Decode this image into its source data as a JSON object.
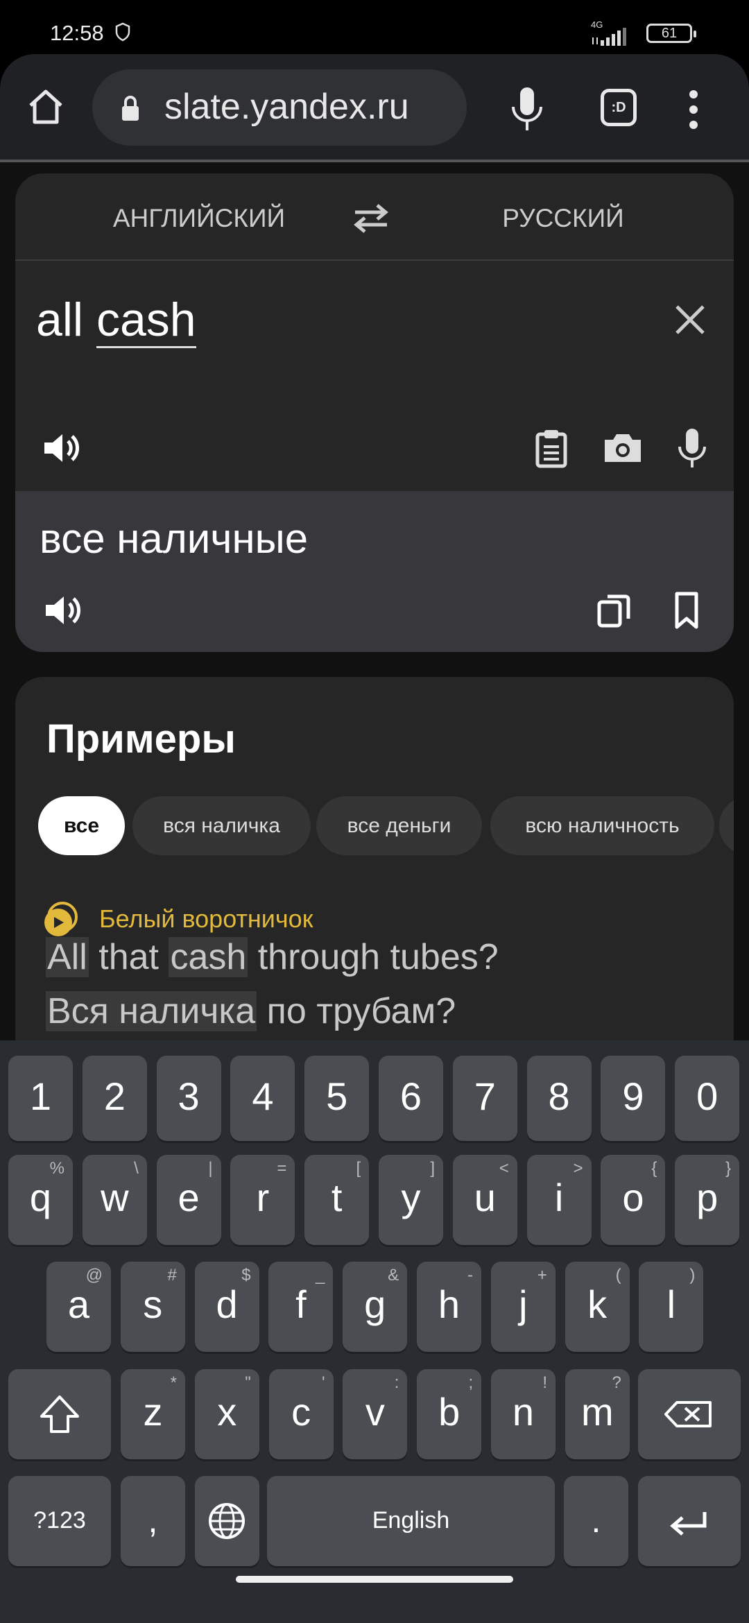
{
  "status": {
    "time": "12:58",
    "network": "4G",
    "battery": "61"
  },
  "browser": {
    "url": "slate.yandex.ru",
    "tab_icon": ":D"
  },
  "translator": {
    "source_lang": "АНГЛИЙСКИЙ",
    "target_lang": "РУССКИЙ",
    "input_word1": "all",
    "input_word2": "cash",
    "output": "все наличные"
  },
  "examples": {
    "title": "Примеры",
    "chips": [
      "все",
      "вся наличка",
      "все деньги",
      "всю наличность"
    ],
    "source": "Белый воротничок",
    "sentence_en": [
      {
        "t": "All",
        "hl": true
      },
      {
        "t": " that ",
        "hl": false
      },
      {
        "t": "cash",
        "hl": true
      },
      {
        "t": " through tubes?",
        "hl": false
      }
    ],
    "sentence_ru": [
      {
        "t": "Вся наличка",
        "hl": true
      },
      {
        "t": " по трубам?",
        "hl": false
      }
    ]
  },
  "keyboard": {
    "row1": [
      [
        "1",
        ""
      ],
      [
        "2",
        ""
      ],
      [
        "3",
        ""
      ],
      [
        "4",
        ""
      ],
      [
        "5",
        ""
      ],
      [
        "6",
        ""
      ],
      [
        "7",
        ""
      ],
      [
        "8",
        ""
      ],
      [
        "9",
        ""
      ],
      [
        "0",
        ""
      ]
    ],
    "row2": [
      [
        "q",
        "%"
      ],
      [
        "w",
        "\\"
      ],
      [
        "e",
        "|"
      ],
      [
        "r",
        "="
      ],
      [
        "t",
        "["
      ],
      [
        "y",
        "]"
      ],
      [
        "u",
        "<"
      ],
      [
        "i",
        ">"
      ],
      [
        "o",
        "{"
      ],
      [
        "p",
        "}"
      ]
    ],
    "row3": [
      [
        "a",
        "@"
      ],
      [
        "s",
        "#"
      ],
      [
        "d",
        "$"
      ],
      [
        "f",
        "_"
      ],
      [
        "g",
        "&"
      ],
      [
        "h",
        "-"
      ],
      [
        "j",
        "+"
      ],
      [
        "k",
        "("
      ],
      [
        "l",
        ")"
      ]
    ],
    "row4": [
      [
        "z",
        "*"
      ],
      [
        "x",
        "\""
      ],
      [
        "c",
        "'"
      ],
      [
        "v",
        ":"
      ],
      [
        "b",
        ";"
      ],
      [
        "n",
        "!"
      ],
      [
        "m",
        "?"
      ]
    ],
    "symbols": "?123",
    "comma": ",",
    "space": "English",
    "period": ".",
    "enter_color": "#5e97f6"
  }
}
